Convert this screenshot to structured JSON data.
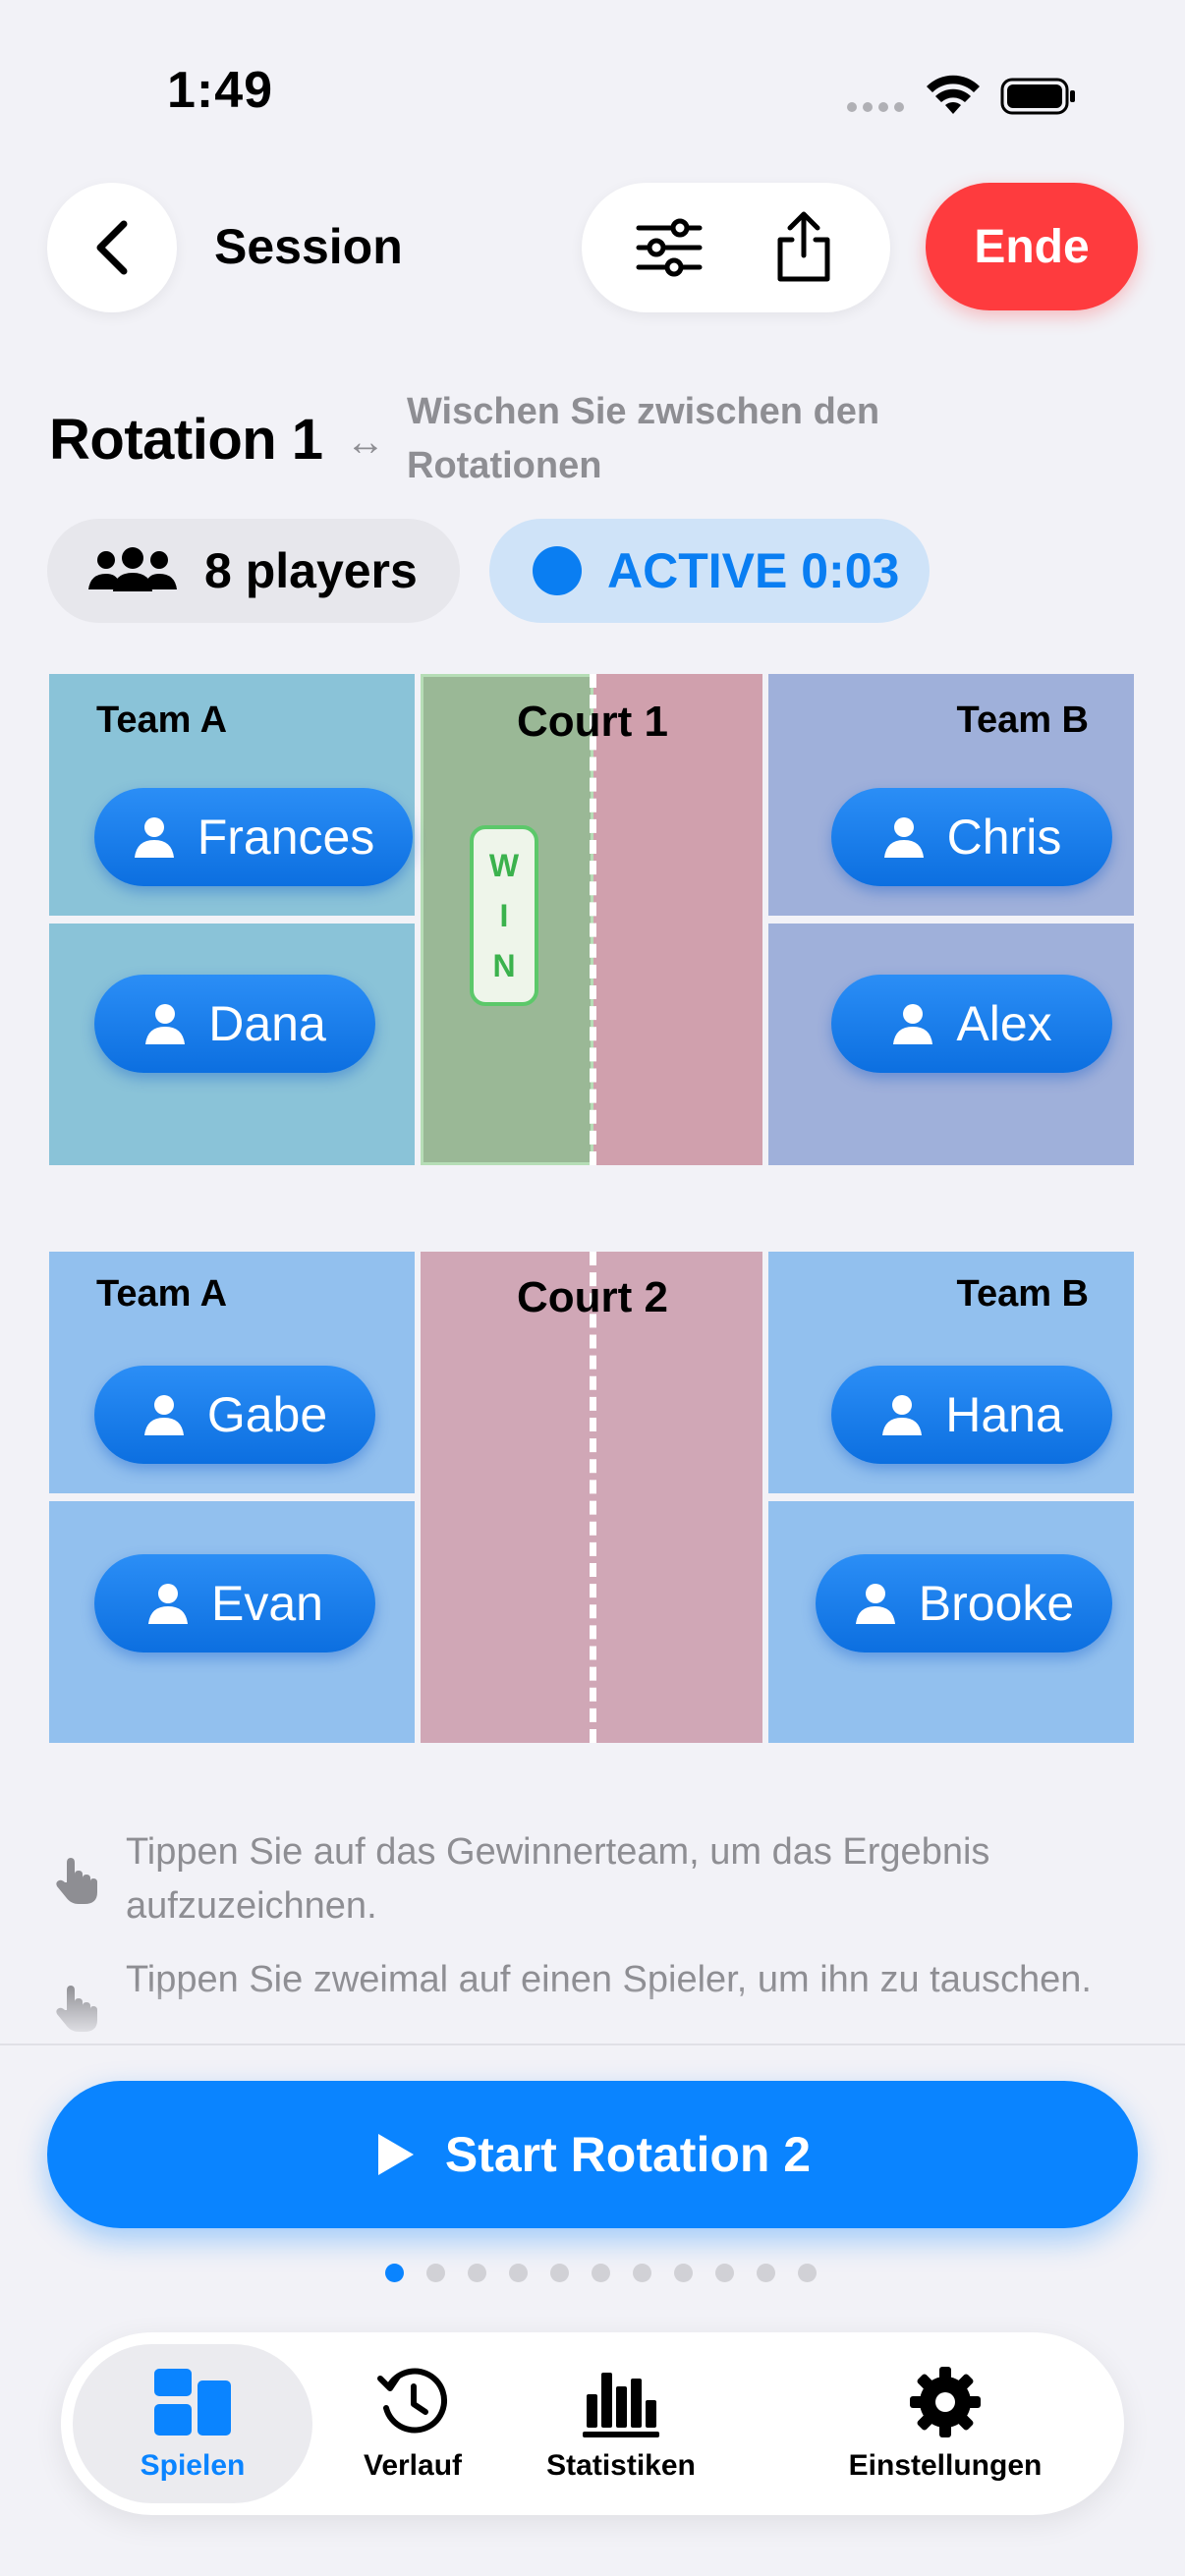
{
  "status_bar": {
    "time": "1:49"
  },
  "header": {
    "title": "Session",
    "end_label": "Ende"
  },
  "rotation": {
    "title": "Rotation 1",
    "swap_symbol": "↔",
    "swipe_hint": "Wischen Sie zwischen den Rotationen",
    "players_label": "8 players",
    "active_label": "ACTIVE 0:03"
  },
  "courts": [
    {
      "title": "Court 1",
      "team_a": {
        "label": "Team A",
        "players": [
          "Frances",
          "Dana"
        ]
      },
      "team_b": {
        "label": "Team B",
        "players": [
          "Chris",
          "Alex"
        ]
      },
      "win_badge": [
        "W",
        "I",
        "N"
      ]
    },
    {
      "title": "Court 2",
      "team_a": {
        "label": "Team A",
        "players": [
          "Gabe",
          "Evan"
        ]
      },
      "team_b": {
        "label": "Team B",
        "players": [
          "Hana",
          "Brooke"
        ]
      }
    }
  ],
  "hints": [
    "Tippen Sie auf das Gewinnerteam, um das Ergebnis aufzuzeichnen.",
    "Tippen Sie zweimal auf einen Spieler, um ihn zu tauschen."
  ],
  "start_button_label": "Start Rotation 2",
  "pagination": {
    "current": 1,
    "total": 11
  },
  "tabs": [
    {
      "label": "Spielen",
      "icon": "grid-icon",
      "selected": true
    },
    {
      "label": "Verlauf",
      "icon": "history-icon",
      "selected": false
    },
    {
      "label": "Statistiken",
      "icon": "bar-chart-icon",
      "selected": false
    },
    {
      "label": "Einstellungen",
      "icon": "gear-icon",
      "selected": false
    }
  ],
  "colors": {
    "accent": "#0a84ff",
    "end_button": "#fe3b3e",
    "court1_team_a": "#8ac3d8",
    "court1_team_b": "#9fb0da",
    "court2_team": "#92c0ee",
    "court_floor": "#d0a7b6",
    "win_zone": "#9ab896"
  }
}
